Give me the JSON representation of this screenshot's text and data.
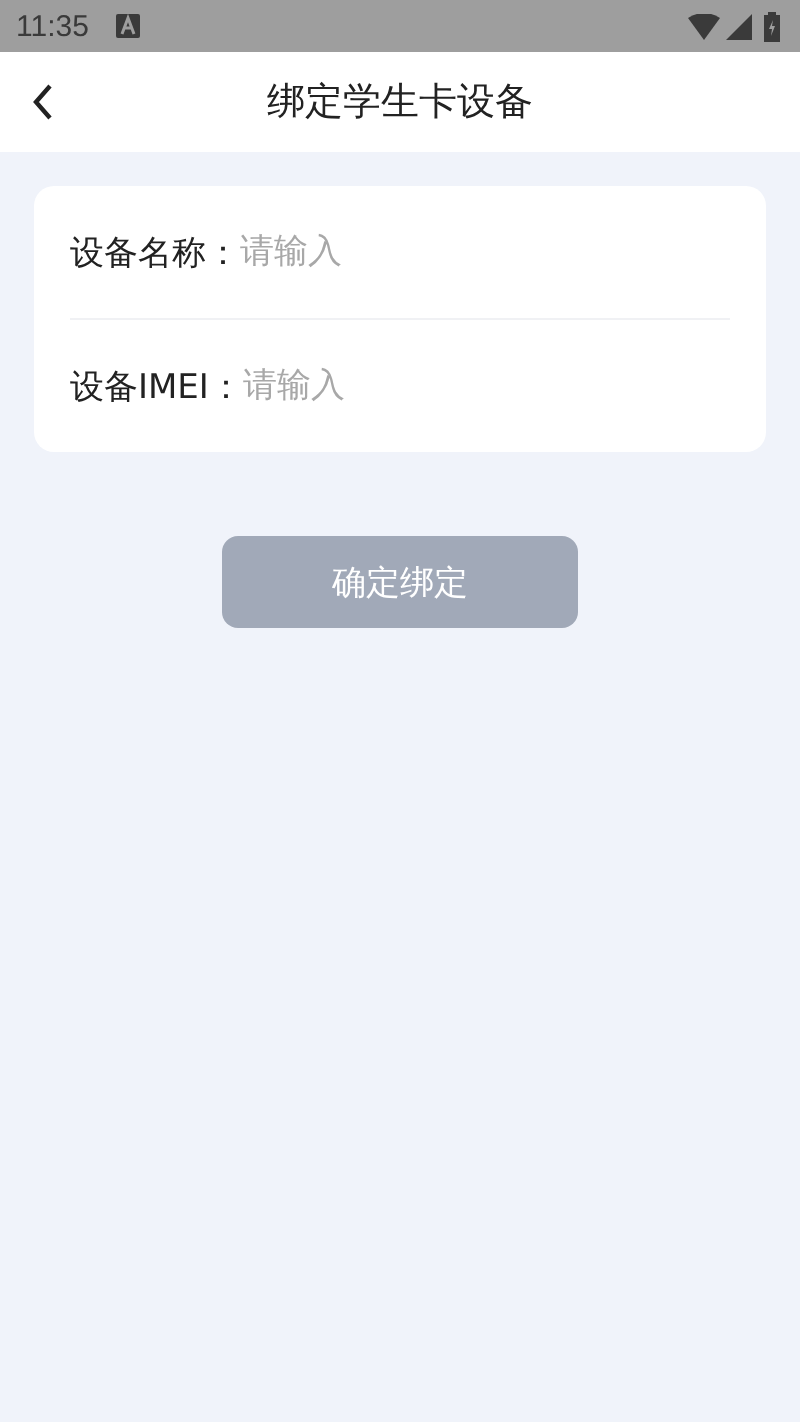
{
  "status_bar": {
    "time": "11:35"
  },
  "header": {
    "title": "绑定学生卡设备"
  },
  "form": {
    "fields": [
      {
        "label": "设备名称：",
        "placeholder": "请输入"
      },
      {
        "label": "设备IMEI：",
        "placeholder": "请输入"
      }
    ]
  },
  "submit": {
    "label": "确定绑定",
    "disabled": true
  }
}
